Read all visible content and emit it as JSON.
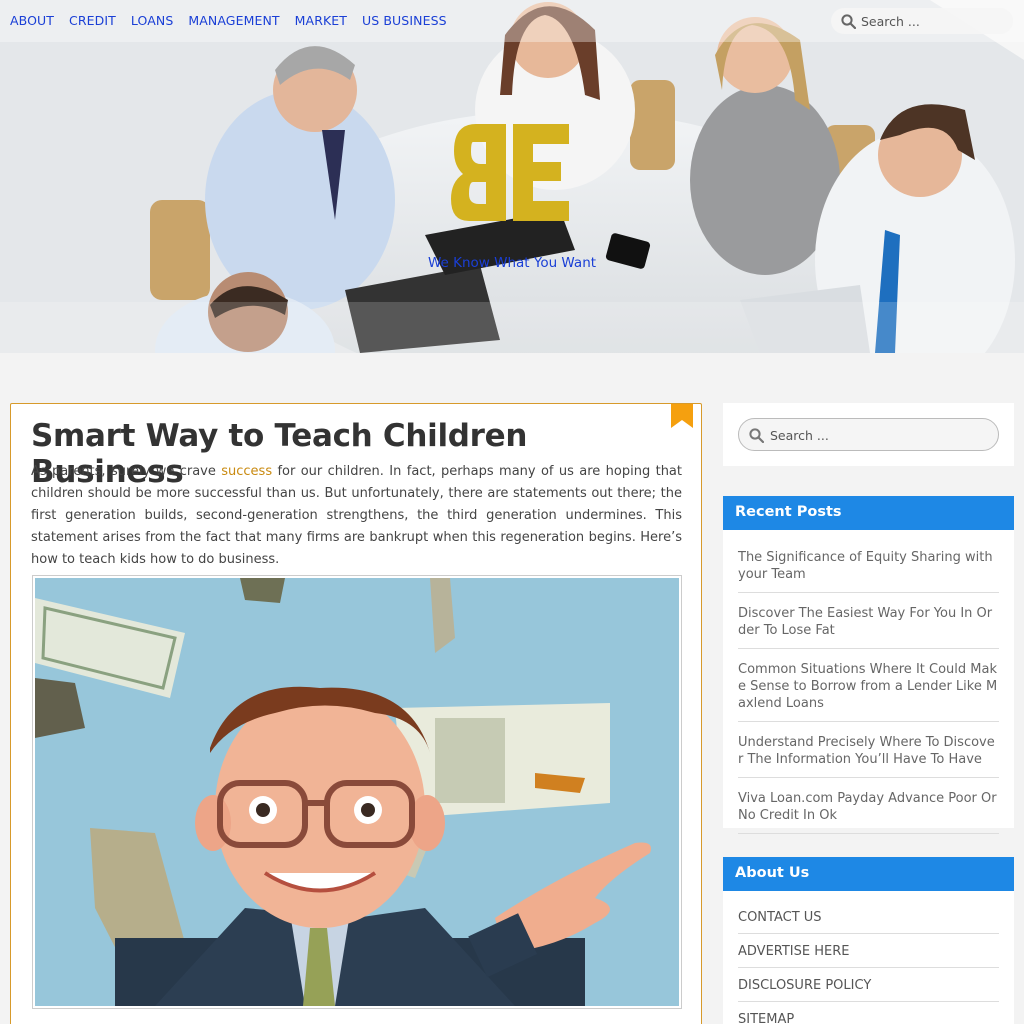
{
  "header": {
    "nav": [
      "ABOUT",
      "CREDIT",
      "LOANS",
      "MANAGEMENT",
      "MARKET",
      "US BUSINESS"
    ],
    "search_placeholder": "Search ...",
    "tagline": "We Know What You Want",
    "logo_colour": "#d4b21f"
  },
  "post": {
    "title": "Smart Way to Teach Children Business",
    "excerpt_before": "As parents, surely we crave ",
    "excerpt_link": "success",
    "excerpt_after": " for our children. In fact, perhaps many of us are hoping that children should be more successful than us. But unfortunately, there are statements out there; the first generation builds, second-generation strengthens, the third generation undermines. This statement arises from the fact that many firms are bankrupt when this regeneration begins. Here’s how to teach kids how to do business.",
    "accent_colour": "#d79a2b"
  },
  "sidebar": {
    "search_placeholder": "Search ...",
    "recent_title": "Recent Posts",
    "recent_posts": [
      "The Significance of Equity Sharing with your Team",
      "Discover The Easiest Way For You In Order To Lose Fat",
      "Common Situations Where It Could Make Sense to Borrow from a Lender Like Maxlend Loans",
      "Understand Precisely Where To Discover The Information You’ll Have To Have",
      "Viva Loan.com Payday Advance Poor Or No Credit In Ok"
    ],
    "about_title": "About Us",
    "about_links": [
      "CONTACT US",
      "ADVERTISE HERE",
      "DISCLOSURE POLICY",
      "SITEMAP"
    ],
    "head_colour": "#1e88e5"
  }
}
